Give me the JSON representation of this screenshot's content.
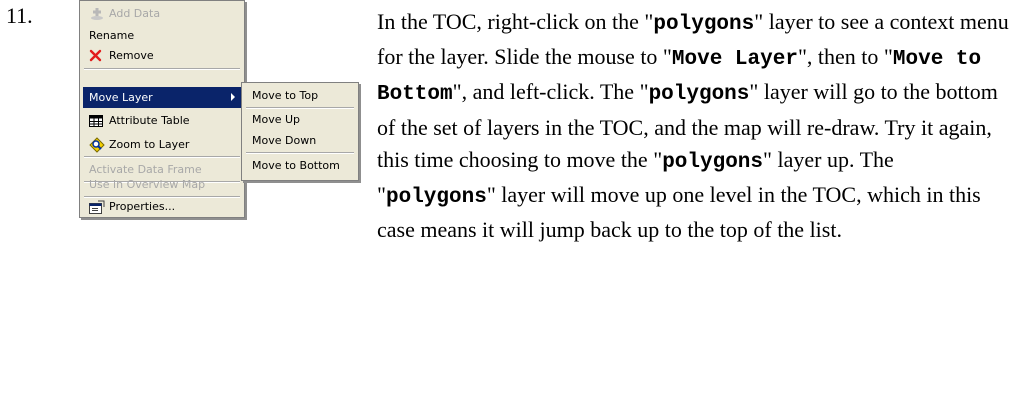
{
  "step_number": "11.",
  "context_menu": {
    "items": [
      {
        "label": "Add Data",
        "icon": "add-data-icon",
        "disabled": true
      },
      {
        "label": "Rename",
        "icon": "",
        "disabled": false
      },
      {
        "label": "Remove",
        "icon": "red-x-icon",
        "disabled": false
      },
      {
        "label": "Move Layer",
        "icon": "",
        "disabled": false,
        "selected": true,
        "submenu": true
      },
      {
        "label": "Attribute Table",
        "icon": "table-icon",
        "disabled": false
      },
      {
        "label": "Zoom to Layer",
        "icon": "zoom-to-layer-icon",
        "disabled": false
      },
      {
        "label": "Activate Data Frame",
        "icon": "",
        "disabled": true
      },
      {
        "label": "Use in Overview Map",
        "icon": "",
        "disabled": true
      },
      {
        "label": "Properties...",
        "icon": "properties-icon",
        "disabled": false
      }
    ],
    "submenu": [
      "Move to Top",
      "Move Up",
      "Move Down",
      "Move to Bottom"
    ]
  },
  "instructions": {
    "p1": "In the TOC, right-click on the \"",
    "b1": "polygons",
    "p2": "\" layer to see a context menu for the layer. Slide the mouse to \"",
    "b2": "Move Layer",
    "p3": "\", then to \"",
    "b3": "Move to Bottom",
    "p4": "\", and left-click. The \"",
    "b4": "polygons",
    "p5": "\" layer will go to the bottom of the set of layers in the TOC, and the map will re-draw. Try it again, this time choosing to move the \"",
    "b5": "polygons",
    "p6": "\" layer up. The \"",
    "b6": "polygons",
    "p7": "\" layer will move up one level in the TOC, which in this case means it will jump back up to the top of the list."
  },
  "colors": {
    "menu_bg": "#ece9d8",
    "highlight": "#0a246a",
    "remove_x": "#e21b1b",
    "disabled_text": "#a8a8a8"
  }
}
